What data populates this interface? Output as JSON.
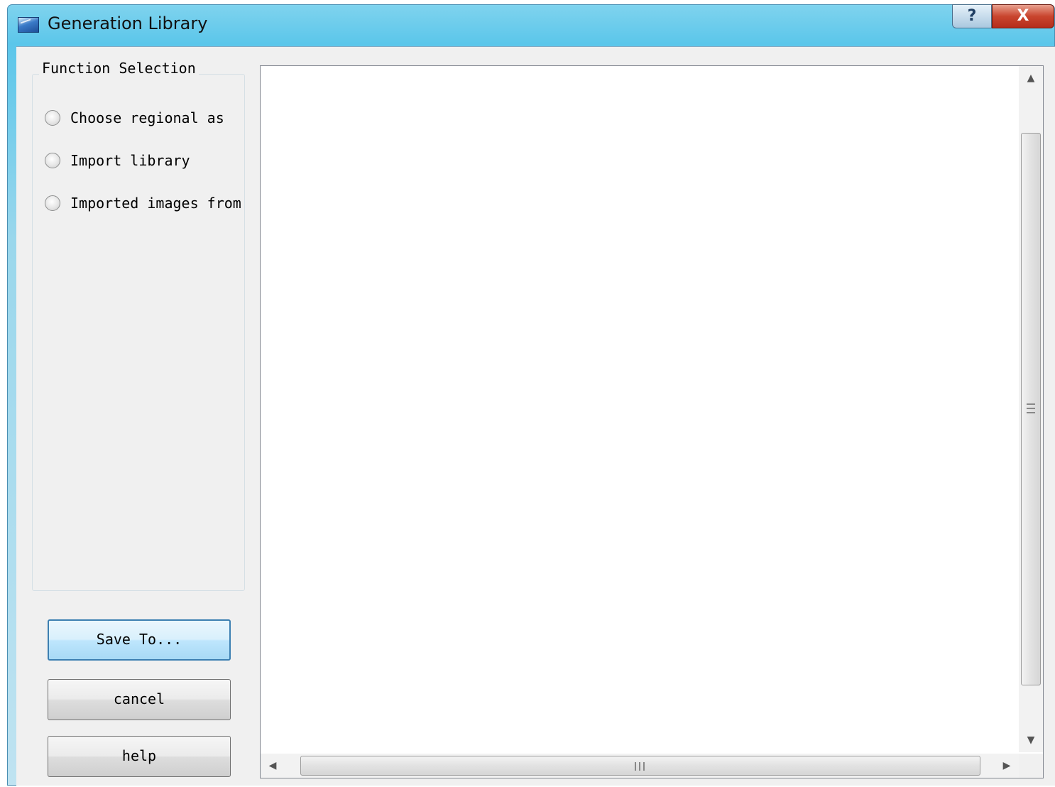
{
  "window": {
    "title": "Generation Library",
    "help_glyph": "?",
    "close_glyph": "X"
  },
  "function_selection": {
    "title": "Function Selection",
    "options": [
      {
        "label": "Choose regional as",
        "selected": false
      },
      {
        "label": "Import library",
        "selected": false
      },
      {
        "label": "Imported images from",
        "selected": false
      }
    ]
  },
  "buttons": {
    "save": "Save To...",
    "cancel": "cancel",
    "help": "help"
  },
  "scrollbars": {
    "up_arrow": "▲",
    "down_arrow": "▼",
    "left_arrow": "◀",
    "right_arrow": "▶"
  },
  "colors": {
    "title_bar": "#5bc6ea",
    "close_button": "#c9452e",
    "default_button_border": "#3c7fb1",
    "client_background": "#f0f0f0"
  }
}
